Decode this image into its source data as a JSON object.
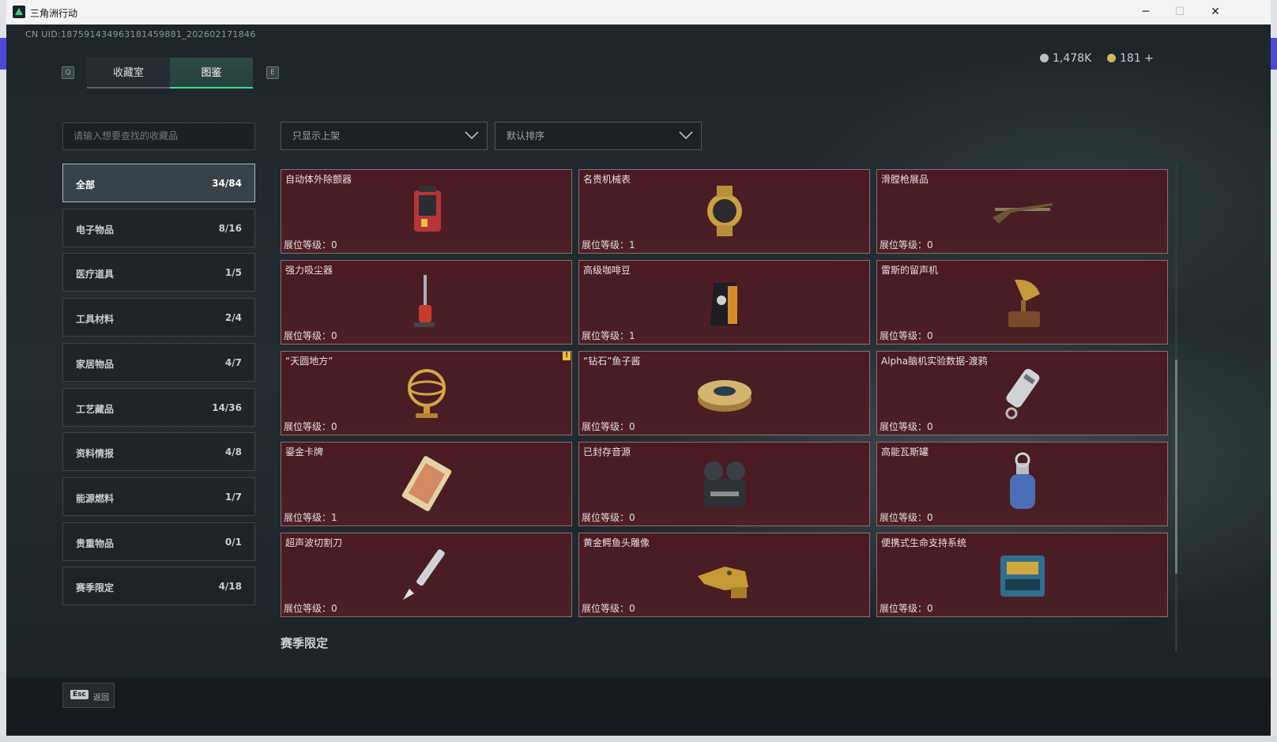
{
  "window": {
    "title": "三角洲行动",
    "minimize": "─",
    "maximize": "☐",
    "close": "✕"
  },
  "header": {
    "uid": "CN UID:187591434963181459881_202602171846",
    "currency_silver": "1,478K",
    "currency_gold": "181 +"
  },
  "tabs": {
    "left_key": "Q",
    "right_key": "E",
    "items": [
      {
        "label": "收藏室",
        "active": false
      },
      {
        "label": "图鉴",
        "active": true
      }
    ]
  },
  "search": {
    "placeholder": "请输入想要查找的收藏品"
  },
  "categories": [
    {
      "label": "全部",
      "count": "34/84",
      "active": true
    },
    {
      "label": "电子物品",
      "count": "8/16"
    },
    {
      "label": "医疗道具",
      "count": "1/5"
    },
    {
      "label": "工具材料",
      "count": "2/4"
    },
    {
      "label": "家居物品",
      "count": "4/7"
    },
    {
      "label": "工艺藏品",
      "count": "14/36"
    },
    {
      "label": "资料情报",
      "count": "4/8"
    },
    {
      "label": "能源燃料",
      "count": "1/7"
    },
    {
      "label": "贵重物品",
      "count": "0/1"
    },
    {
      "label": "赛季限定",
      "count": "4/18"
    }
  ],
  "filters": {
    "filter_value": "只显示上架",
    "sort_value": "默认排序"
  },
  "items": [
    {
      "name": "自动体外除颤器",
      "level": "展位等级：0",
      "icon": "defibrillator-icon"
    },
    {
      "name": "名贵机械表",
      "level": "展位等级：1",
      "icon": "luxury-watch-icon"
    },
    {
      "name": "滑膛枪展品",
      "level": "展位等级：0",
      "icon": "musket-icon"
    },
    {
      "name": "强力吸尘器",
      "level": "展位等级：0",
      "icon": "vacuum-cleaner-icon"
    },
    {
      "name": "高级咖啡豆",
      "level": "展位等级：1",
      "icon": "coffee-bag-icon"
    },
    {
      "name": "雷斯的留声机",
      "level": "展位等级：0",
      "icon": "gramophone-icon"
    },
    {
      "name": "“天圆地方”",
      "level": "展位等级：0",
      "icon": "armillary-sphere-icon",
      "warn": "!"
    },
    {
      "name": "“钻石”鱼子酱",
      "level": "展位等级：0",
      "icon": "caviar-tin-icon"
    },
    {
      "name": "Alpha脑机实验数据-渡鸦",
      "level": "展位等级：0",
      "icon": "data-canister-icon"
    },
    {
      "name": "鎏金卡牌",
      "level": "展位等级：1",
      "icon": "gilded-card-icon"
    },
    {
      "name": "已封存音源",
      "level": "展位等级：0",
      "icon": "reel-recorder-icon"
    },
    {
      "name": "高能瓦斯罐",
      "level": "展位等级：0",
      "icon": "gas-canister-icon"
    },
    {
      "name": "超声波切割刀",
      "level": "展位等级：0",
      "icon": "ultrasonic-knife-icon"
    },
    {
      "name": "黄金鳄鱼头雕像",
      "level": "展位等级：0",
      "icon": "golden-crocodile-icon"
    },
    {
      "name": "便携式生命支持系统",
      "level": "展位等级：0",
      "icon": "life-support-icon"
    }
  ],
  "section": {
    "title": "赛季限定"
  },
  "footer": {
    "esc_key": "Esc",
    "esc_label": "返回"
  },
  "colors": {
    "accent_green": "#37e0a0",
    "card_bg": "#4a1b22",
    "card_border": "#8c6e72"
  }
}
